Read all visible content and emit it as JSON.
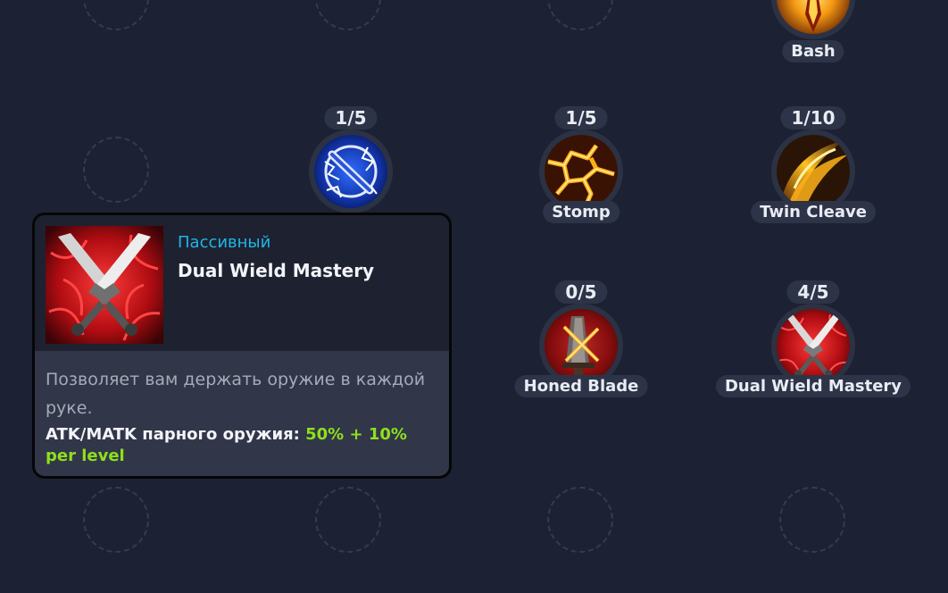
{
  "skills": {
    "bash": {
      "name": "Bash",
      "icon": "fire-blade-icon"
    },
    "shield": {
      "level": "1/5",
      "icon": "lightning-shield-icon"
    },
    "stomp": {
      "name": "Stomp",
      "level": "1/5",
      "icon": "cracked-lava-icon"
    },
    "twin_cleave": {
      "name": "Twin Cleave",
      "level": "1/10",
      "icon": "fire-slash-icon"
    },
    "honed_blade": {
      "name": "Honed Blade",
      "level": "0/5",
      "icon": "fire-sword-icon"
    },
    "dual_wield_mastery": {
      "name": "Dual Wield Mastery",
      "level": "4/5",
      "icon": "crossed-daggers-icon"
    }
  },
  "tooltip": {
    "type": "Пассивный",
    "title": "Dual Wield Mastery",
    "icon": "crossed-daggers-icon",
    "description": "Позволяет вам держать оружие в каждой руке.",
    "stat_label": "ATK/MATK парного оружия: ",
    "stat_value": "50% + 10% per level"
  },
  "colors": {
    "background": "#1c2233",
    "type_text": "#1fb6e8",
    "stat_value": "#8ee01a"
  }
}
